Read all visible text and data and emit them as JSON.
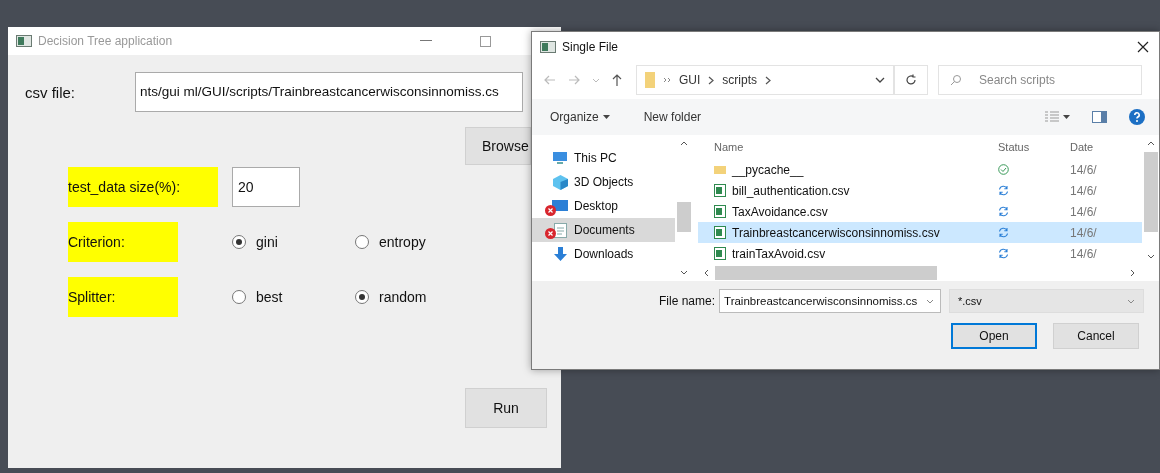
{
  "main_window": {
    "title": "Decision Tree application",
    "csv_label": "csv file:",
    "csv_path": "nts/gui ml/GUI/scripts/Trainbreastcancerwisconsinnomiss.cs",
    "browse_button": "Browse",
    "test_size": {
      "label": "test_data size(%):",
      "value": "20"
    },
    "option_groups": [
      {
        "label": "Criterion:",
        "options": [
          {
            "label": "gini",
            "selected": true
          },
          {
            "label": "entropy",
            "selected": false
          }
        ]
      },
      {
        "label": "Splitter:",
        "options": [
          {
            "label": "best",
            "selected": false
          },
          {
            "label": "random",
            "selected": true
          }
        ]
      }
    ],
    "run_button": "Run"
  },
  "dialog": {
    "title": "Single File",
    "breadcrumb": [
      "GUI",
      "scripts"
    ],
    "search": {
      "placeholder": "Search scripts"
    },
    "toolbar": [
      "Organize",
      "New folder"
    ],
    "sidebar": [
      {
        "label": "This PC",
        "kind": "pc",
        "selected": false,
        "error": false
      },
      {
        "label": "3D Objects",
        "kind": "cube",
        "selected": false,
        "error": false
      },
      {
        "label": "Desktop",
        "kind": "desktop",
        "selected": false,
        "error": true
      },
      {
        "label": "Documents",
        "kind": "documents",
        "selected": true,
        "error": true
      },
      {
        "label": "Downloads",
        "kind": "downloads",
        "selected": false,
        "error": false
      }
    ],
    "columns": [
      "Name",
      "Status",
      "Date"
    ],
    "files": [
      {
        "name": "__pycache__",
        "kind": "folder",
        "synced": true,
        "date": "14/6/",
        "selected": false
      },
      {
        "name": "bill_authentication.csv",
        "kind": "csv",
        "synced": false,
        "date": "14/6/",
        "selected": false
      },
      {
        "name": "TaxAvoidance.csv",
        "kind": "csv",
        "synced": false,
        "date": "14/6/",
        "selected": false
      },
      {
        "name": "Trainbreastcancerwisconsinnomiss.csv",
        "kind": "csv",
        "synced": false,
        "date": "14/6/",
        "selected": true
      },
      {
        "name": "trainTaxAvoid.csv",
        "kind": "csv",
        "synced": false,
        "date": "14/6/",
        "selected": false
      }
    ],
    "file_name": {
      "label": "File name:",
      "value": "Trainbreastcancerwisconsinnomiss.cs"
    },
    "filter": "*.csv",
    "buttons": [
      {
        "label": "Open",
        "default": true
      },
      {
        "label": "Cancel",
        "default": false
      }
    ]
  }
}
